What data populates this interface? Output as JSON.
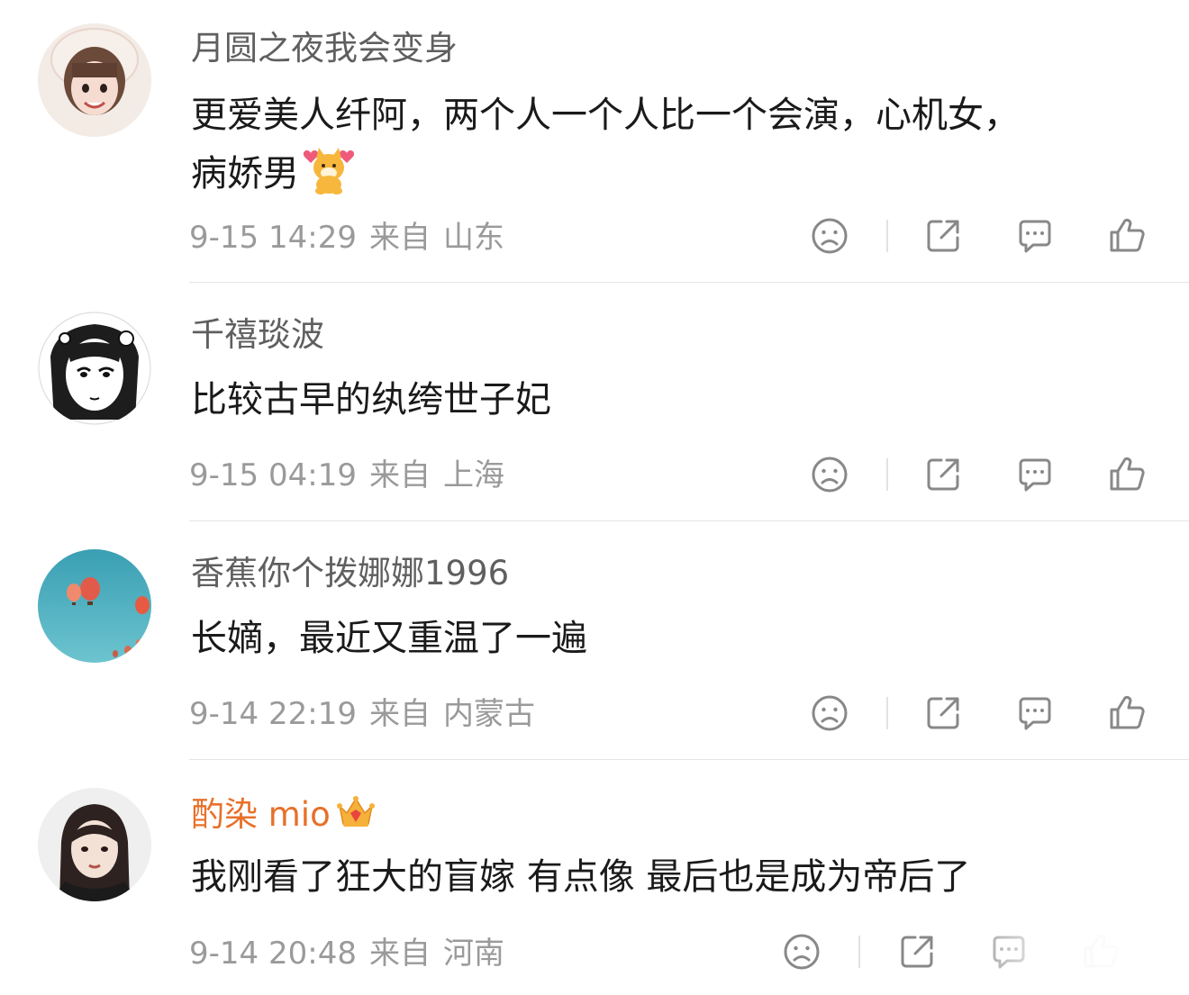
{
  "comments": [
    {
      "username": "月圆之夜我会变身",
      "content_line1": "更爱美人纤阿，两个人一个人比一个会演，心机女，",
      "content_line2": "病娇男",
      "time": "9-15 14:29",
      "from": "来自",
      "location": "山东",
      "avatar_icon": "girl-pink-hood-avatar",
      "emoji_icon": "dog-hearts-emoji"
    },
    {
      "username": "千禧琰波",
      "content": "比较古早的纨绔世子妃",
      "time": "9-15 04:19",
      "from": "来自",
      "location": "上海",
      "avatar_icon": "manga-girl-avatar"
    },
    {
      "username": "香蕉你个拨娜娜1996",
      "content": "长嫡，最近又重温了一遍",
      "time": "9-14 22:19",
      "from": "来自",
      "location": "内蒙古",
      "avatar_icon": "hot-air-balloons-avatar"
    },
    {
      "username": "酌染 mio",
      "content": "我刚看了狂大的盲嫁 有点像 最后也是成为帝后了",
      "time": "9-14 20:48",
      "from": "来自",
      "location": "河南",
      "avatar_icon": "girl-dark-hair-avatar",
      "badge_icon": "vip-crown-icon"
    }
  ],
  "colors": {
    "vip_name": "#e8702a",
    "meta_text": "#9a9a9a",
    "content_text": "#1a1a1a",
    "name_text": "#5f5f5f"
  }
}
